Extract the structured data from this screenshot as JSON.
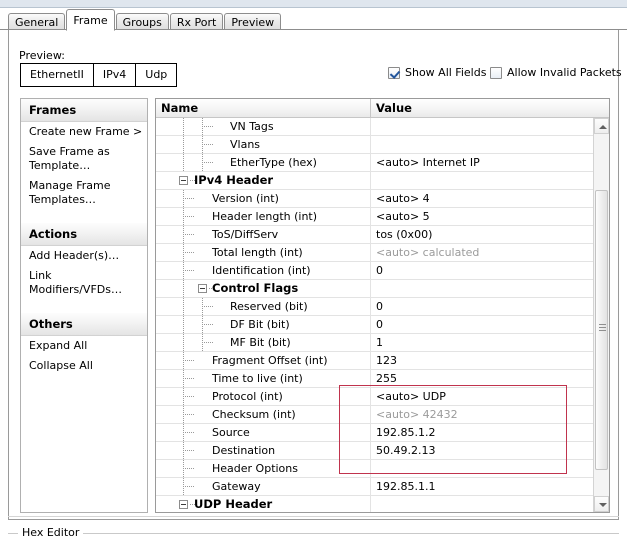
{
  "window": {
    "tabs": [
      {
        "label": "General",
        "active": false
      },
      {
        "label": "Frame",
        "active": true
      },
      {
        "label": "Groups",
        "active": false
      },
      {
        "label": "Rx Port",
        "active": false
      },
      {
        "label": "Preview",
        "active": false
      }
    ]
  },
  "toolbar": {
    "preview_label": "Preview:",
    "segments": [
      "EthernetII",
      "IPv4",
      "Udp"
    ],
    "show_all_fields": {
      "label": "Show All Fields",
      "checked": true
    },
    "allow_invalid_packets": {
      "label": "Allow Invalid Packets",
      "checked": false
    }
  },
  "sidebar": {
    "groups": [
      {
        "title": "Frames",
        "items": [
          "Create new Frame >",
          "Save Frame as\nTemplate…",
          "Manage Frame\nTemplates…"
        ]
      },
      {
        "title": "Actions",
        "items": [
          "Add Header(s)…",
          "Link Modifiers/VFDs…"
        ]
      },
      {
        "title": "Others",
        "items": [
          "Expand All",
          "Collapse All"
        ]
      }
    ]
  },
  "tree": {
    "columns": {
      "name": "Name",
      "value": "Value"
    },
    "rows": [
      {
        "name": "VN Tags",
        "value": "",
        "level": 2,
        "kind": "leaf",
        "dim": false
      },
      {
        "name": "Vlans",
        "value": "",
        "level": 2,
        "kind": "leaf",
        "dim": false
      },
      {
        "name": "EtherType (hex)",
        "value": "<auto> Internet IP",
        "level": 2,
        "kind": "leaf",
        "dim": false
      },
      {
        "name": "IPv4 Header",
        "value": "",
        "level": 0,
        "kind": "group",
        "dim": false
      },
      {
        "name": "Version (int)",
        "value": "<auto> 4",
        "level": 1,
        "kind": "leaf",
        "dim": false
      },
      {
        "name": "Header length (int)",
        "value": "<auto> 5",
        "level": 1,
        "kind": "leaf",
        "dim": false
      },
      {
        "name": "ToS/DiffServ",
        "value": "tos (0x00)",
        "level": 1,
        "kind": "leaf",
        "dim": false
      },
      {
        "name": "Total length (int)",
        "value": "<auto> calculated",
        "level": 1,
        "kind": "leaf",
        "dim": true
      },
      {
        "name": "Identification (int)",
        "value": "0",
        "level": 1,
        "kind": "leaf",
        "dim": false
      },
      {
        "name": "Control Flags",
        "value": "",
        "level": 1,
        "kind": "group",
        "dim": false
      },
      {
        "name": "Reserved (bit)",
        "value": "0",
        "level": 2,
        "kind": "leaf",
        "dim": false
      },
      {
        "name": "DF Bit (bit)",
        "value": "0",
        "level": 2,
        "kind": "leaf",
        "dim": false
      },
      {
        "name": "MF Bit (bit)",
        "value": "1",
        "level": 2,
        "kind": "leaf",
        "dim": false
      },
      {
        "name": "Fragment Offset (int)",
        "value": "123",
        "level": 1,
        "kind": "leaf",
        "dim": false
      },
      {
        "name": "Time to live (int)",
        "value": "255",
        "level": 1,
        "kind": "leaf",
        "dim": false
      },
      {
        "name": "Protocol (int)",
        "value": "<auto> UDP",
        "level": 1,
        "kind": "leaf",
        "dim": false
      },
      {
        "name": "Checksum (int)",
        "value": "<auto> 42432",
        "level": 1,
        "kind": "leaf",
        "dim": true
      },
      {
        "name": "Source",
        "value": "192.85.1.2",
        "level": 1,
        "kind": "leaf",
        "dim": false
      },
      {
        "name": "Destination",
        "value": "50.49.2.13",
        "level": 1,
        "kind": "leaf",
        "dim": false
      },
      {
        "name": "Header Options",
        "value": "",
        "level": 1,
        "kind": "leaf",
        "dim": false
      },
      {
        "name": "Gateway",
        "value": "192.85.1.1",
        "level": 1,
        "kind": "leaf",
        "dim": false
      },
      {
        "name": "UDP Header",
        "value": "",
        "level": 0,
        "kind": "group",
        "dim": false
      }
    ],
    "highlight": {
      "color": "#c0334d",
      "from_row": "Control Flags",
      "to_row": "Fragment Offset (int)"
    }
  },
  "bottom": {
    "hex_editor_label": "Hex Editor"
  }
}
